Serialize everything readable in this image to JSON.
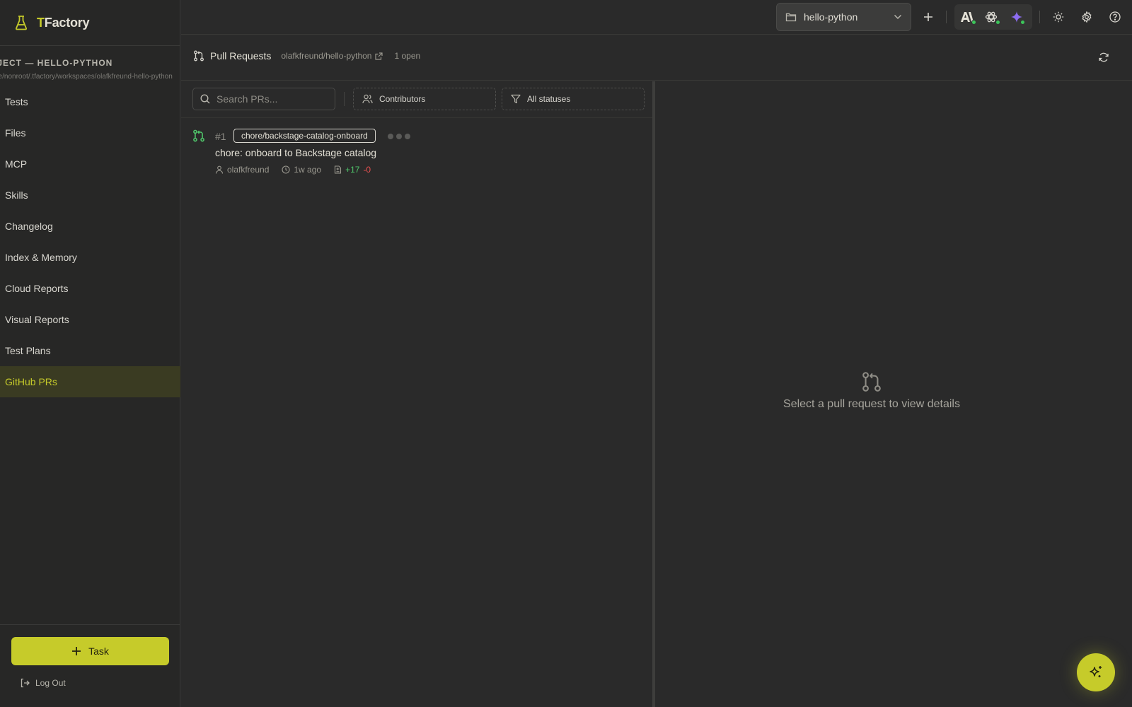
{
  "brand": {
    "prefix": "T",
    "name": "Factory"
  },
  "project": {
    "title": "OJECT — HELLO-PYTHON",
    "path": "ne/nonroot/.tfactory/workspaces/olafkfreund-hello-python"
  },
  "sidebar": {
    "items": [
      {
        "label": "Tests"
      },
      {
        "label": "Files"
      },
      {
        "label": "MCP"
      },
      {
        "label": "Skills"
      },
      {
        "label": "Changelog"
      },
      {
        "label": "Index & Memory"
      },
      {
        "label": "Cloud Reports"
      },
      {
        "label": "Visual Reports"
      },
      {
        "label": "Test Plans"
      },
      {
        "label": "GitHub PRs",
        "active": true
      }
    ],
    "task_button": "Task",
    "logout": "Log Out"
  },
  "topbar": {
    "project_select": "hello-python",
    "icons": [
      "plus-icon",
      "anthropic-icon",
      "openai-icon",
      "gemini-icon",
      "sun-icon",
      "gear-icon",
      "help-icon"
    ]
  },
  "prs": {
    "title": "Pull Requests",
    "repo": "olafkfreund/hello-python",
    "open_count": "1 open",
    "search_placeholder": "Search PRs...",
    "contributors": "Contributors",
    "statuses": "All statuses",
    "items": [
      {
        "number": "#1",
        "branch": "chore/backstage-catalog-onboard",
        "title": "chore: onboard to Backstage catalog",
        "author": "olafkfreund",
        "time": "1w ago",
        "additions": "+17",
        "deletions": "-0"
      }
    ],
    "empty_detail": "Select a pull request to view details"
  },
  "colors": {
    "accent": "#c6cb2a",
    "background": "#2a2a2a",
    "status_green": "#3cc55a",
    "deletions_red": "#e85050"
  }
}
